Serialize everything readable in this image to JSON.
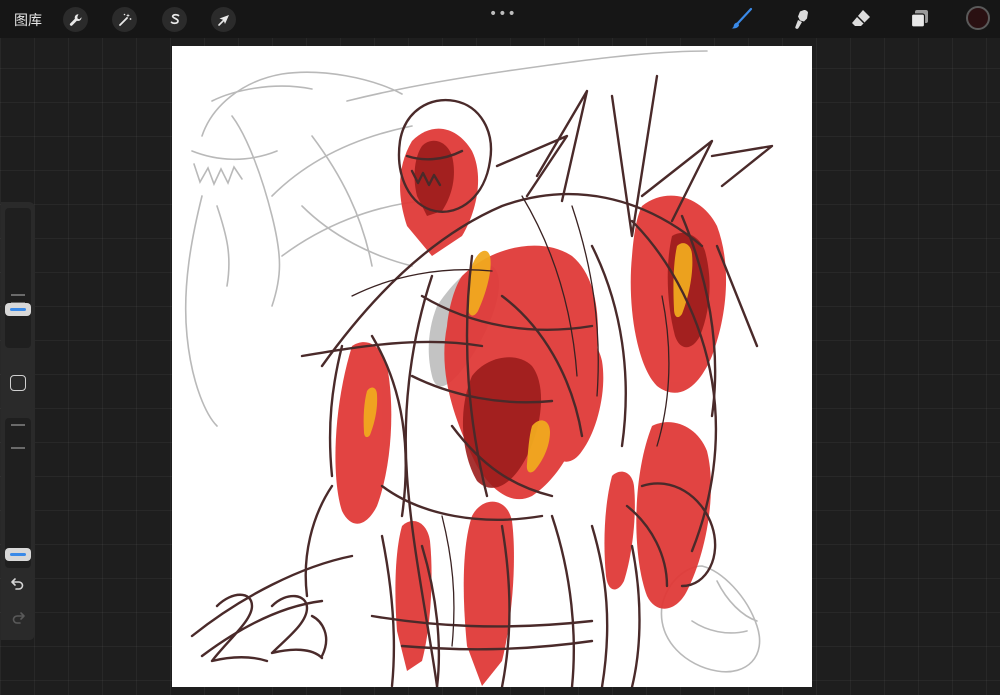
{
  "topbar": {
    "gallery_label": "图库",
    "left_tools": [
      "wrench-icon",
      "magic-wand-icon",
      "selection-s-icon",
      "arrow-cursor-icon"
    ],
    "more_label": "•••",
    "right_tools": [
      "brush-icon",
      "smudge-icon",
      "eraser-icon",
      "layers-icon"
    ],
    "active_color": "#2a1012",
    "accent_color": "#3a8ae8"
  },
  "sidebar": {
    "size_slider_level": 0.25,
    "opacity_slider_level": 0.05
  },
  "canvas": {
    "background": "#ffffff",
    "artwork": "sketch-drawing"
  }
}
